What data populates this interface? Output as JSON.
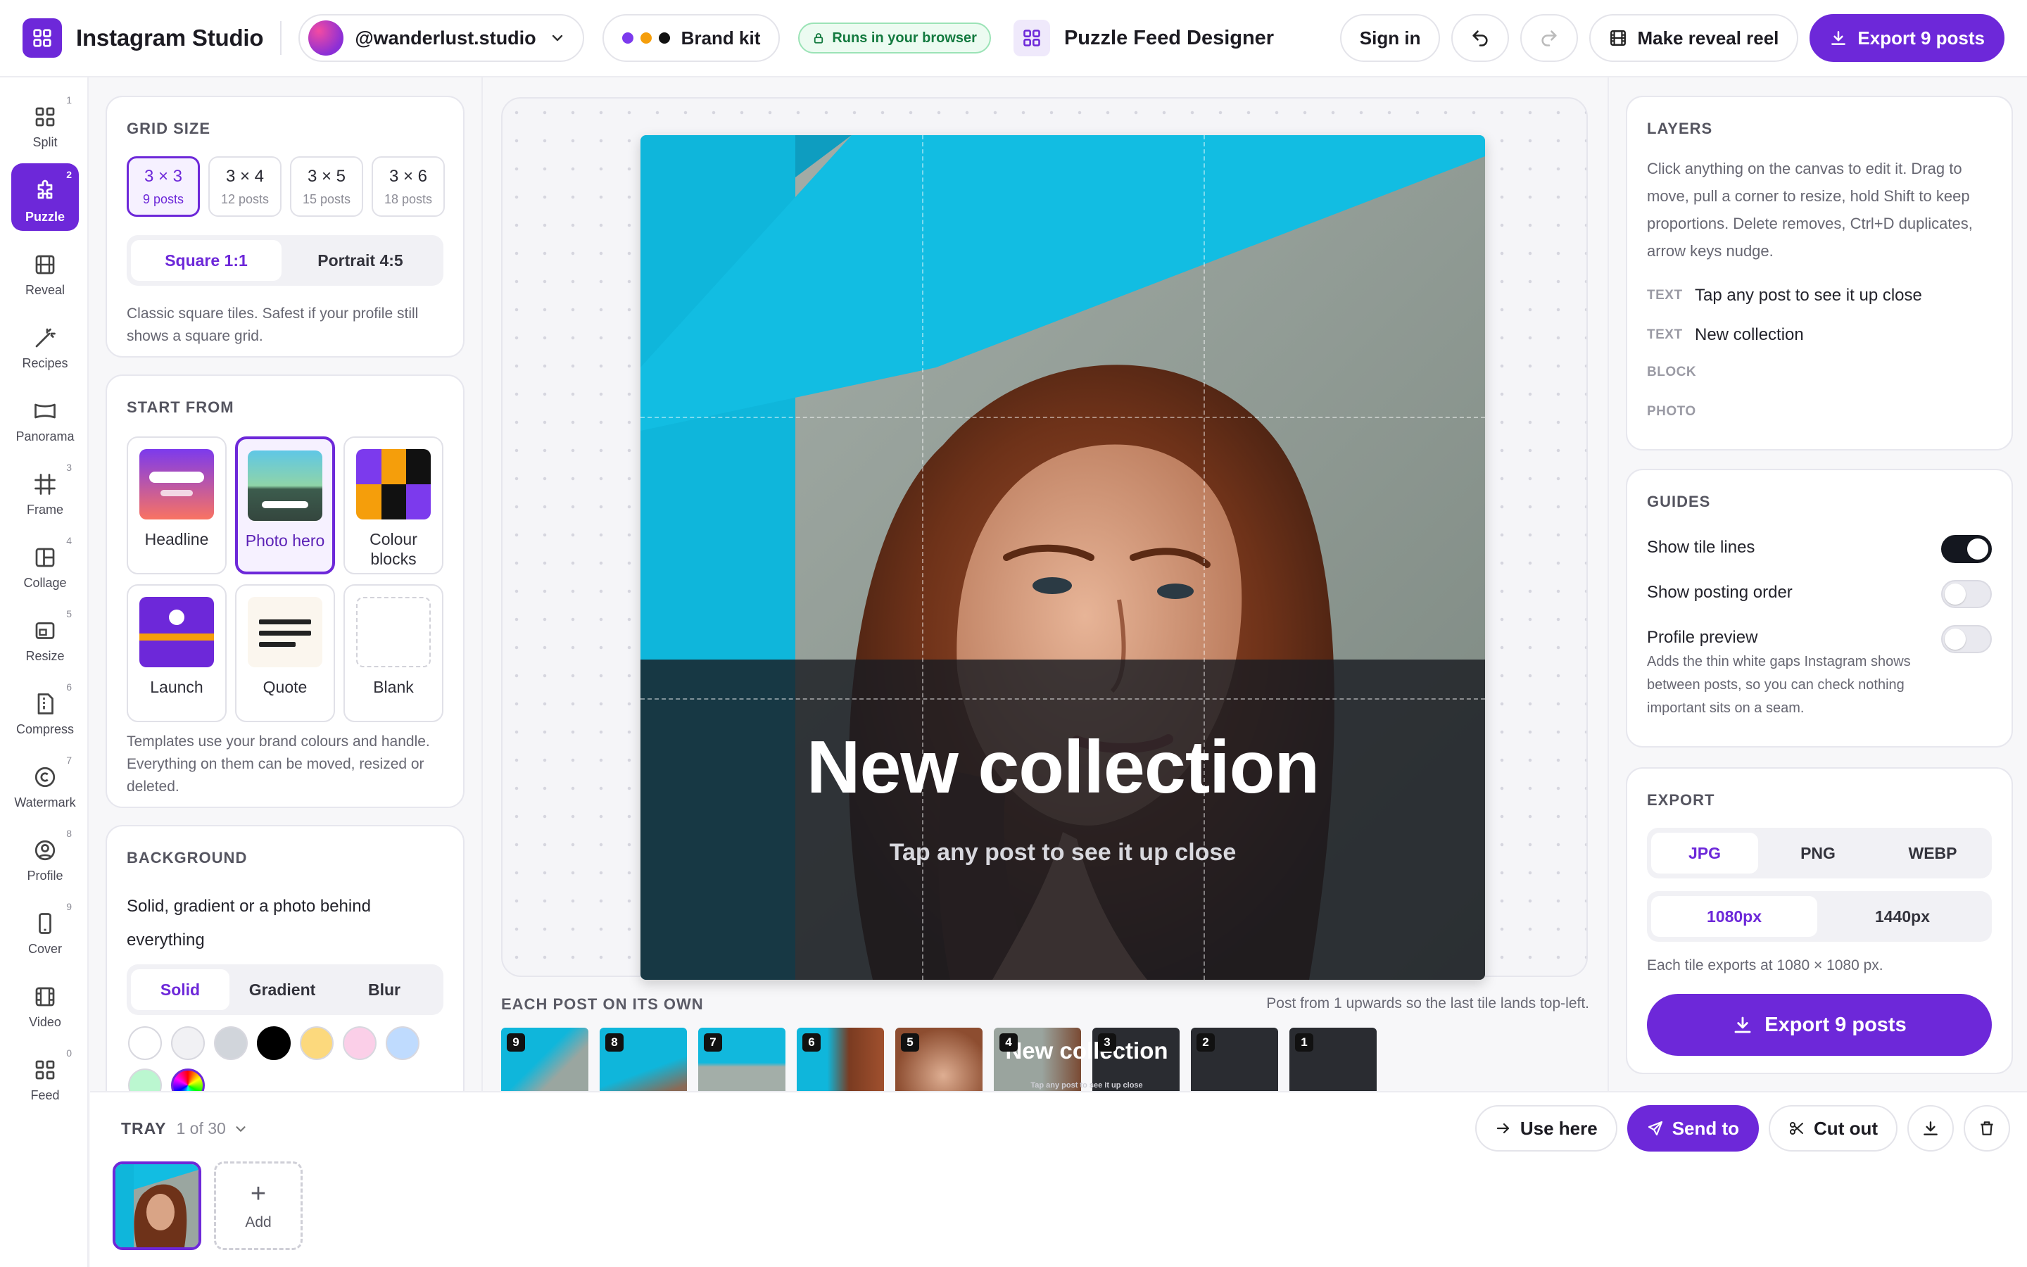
{
  "app": {
    "title": "Instagram Studio",
    "account": "@wanderlust.studio",
    "brand_kit": "Brand kit",
    "runs_badge": "Runs in your browser",
    "tool_title": "Puzzle Feed Designer"
  },
  "topbar": {
    "sign_in": "Sign in",
    "make_reveal": "Make reveal reel",
    "export": "Export 9 posts"
  },
  "rail": [
    {
      "label": "Split",
      "num": "1"
    },
    {
      "label": "Puzzle",
      "num": "2",
      "active": true
    },
    {
      "label": "Reveal",
      "num": ""
    },
    {
      "label": "Recipes",
      "num": ""
    },
    {
      "label": "Panorama",
      "num": ""
    },
    {
      "label": "Frame",
      "num": "3"
    },
    {
      "label": "Collage",
      "num": "4"
    },
    {
      "label": "Resize",
      "num": "5"
    },
    {
      "label": "Compress",
      "num": "6"
    },
    {
      "label": "Watermark",
      "num": "7"
    },
    {
      "label": "Profile",
      "num": "8"
    },
    {
      "label": "Cover",
      "num": "9"
    },
    {
      "label": "Video",
      "num": ""
    },
    {
      "label": "Feed",
      "num": "0"
    }
  ],
  "grid_size": {
    "heading": "GRID SIZE",
    "options": [
      {
        "main": "3 × 3",
        "sub": "9 posts"
      },
      {
        "main": "3 × 4",
        "sub": "12 posts"
      },
      {
        "main": "3 × 5",
        "sub": "15 posts"
      },
      {
        "main": "3 × 6",
        "sub": "18 posts"
      }
    ],
    "shape_square": "Square 1:1",
    "shape_portrait": "Portrait 4:5",
    "hint": "Classic square tiles. Safest if your profile still shows a square grid."
  },
  "start_from": {
    "heading": "START FROM",
    "templates": [
      "Headline",
      "Photo hero",
      "Colour blocks",
      "Launch",
      "Quote",
      "Blank"
    ],
    "hint": "Templates use your brand colours and handle. Everything on them can be moved, resized or deleted."
  },
  "background": {
    "heading": "BACKGROUND",
    "desc": "Solid, gradient or a photo behind everything",
    "tabs": [
      "Solid",
      "Gradient",
      "Blur"
    ],
    "swatches": [
      "#ffffff",
      "#f1f1f4",
      "#d1d5db",
      "#000000",
      "#fcd97d",
      "#fbcfe8",
      "#bfdbfe",
      "#bbf7d0"
    ]
  },
  "canvas": {
    "headline": "New collection",
    "subline": "Tap any post to see it up close"
  },
  "strip": {
    "heading": "EACH POST ON ITS OWN",
    "note": "Post from 1 upwards so the last tile lands top-left.",
    "badges": [
      "9",
      "8",
      "7",
      "6",
      "5",
      "4",
      "3",
      "2",
      "1"
    ],
    "tile_text": "New collection",
    "tile_sub": "Tap any post to see it up close"
  },
  "layers": {
    "heading": "LAYERS",
    "help": "Click anything on the canvas to edit it. Drag to move, pull a corner to resize, hold Shift to keep proportions. Delete removes, Ctrl+D duplicates, arrow keys nudge.",
    "items": [
      {
        "type": "TEXT",
        "name": "Tap any post to see it up close"
      },
      {
        "type": "TEXT",
        "name": "New collection"
      },
      {
        "type": "BLOCK",
        "name": ""
      },
      {
        "type": "PHOTO",
        "name": ""
      }
    ]
  },
  "guides": {
    "heading": "GUIDES",
    "tile_lines": "Show tile lines",
    "tile_lines_on": true,
    "posting_order": "Show posting order",
    "posting_order_on": false,
    "profile_preview": "Profile preview",
    "profile_preview_on": false,
    "profile_preview_desc": "Adds the thin white gaps Instagram shows between posts, so you can check nothing important sits on a seam."
  },
  "export": {
    "heading": "EXPORT",
    "formats": [
      "JPG",
      "PNG",
      "WEBP"
    ],
    "sizes": [
      "1080px",
      "1440px"
    ],
    "note": "Each tile exports at 1080 × 1080 px.",
    "button": "Export 9 posts"
  },
  "tray": {
    "heading": "TRAY",
    "count": "1 of 30",
    "add": "Add",
    "use_here": "Use here",
    "send_to": "Send to",
    "cut_out": "Cut out"
  },
  "colors": {
    "accent": "#6d28d9",
    "brand_dot_1": "#7c3aed",
    "brand_dot_2": "#f59e0b",
    "brand_dot_3": "#111111"
  }
}
